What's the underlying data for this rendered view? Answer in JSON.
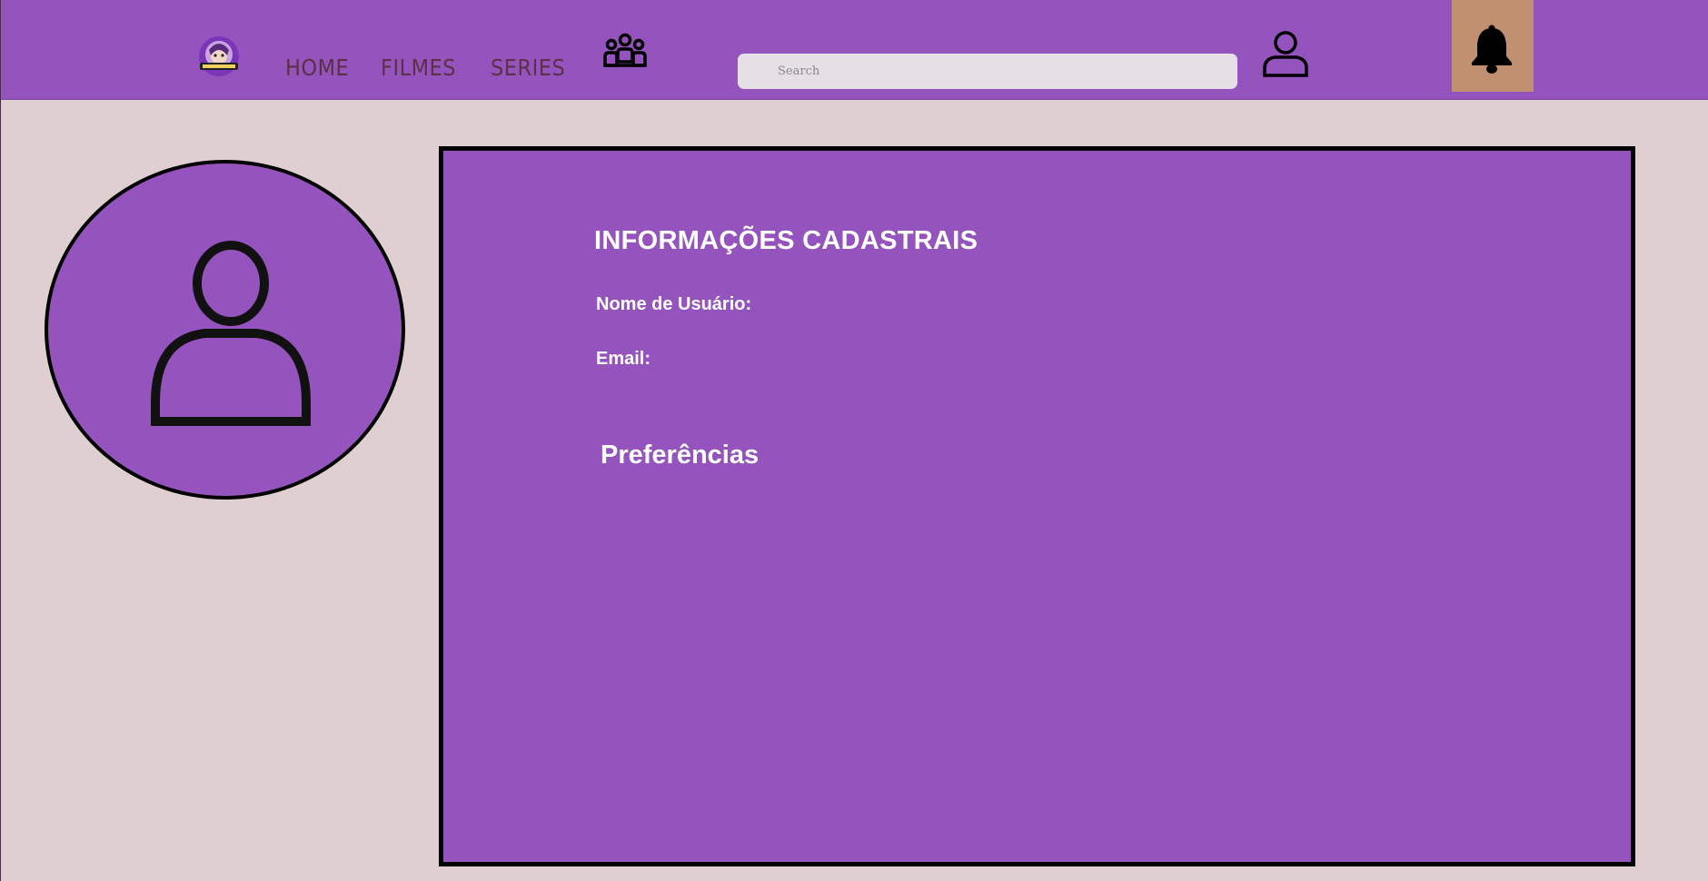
{
  "brand": {
    "logo_name": "animes-anime-logo"
  },
  "nav": {
    "home": "HOME",
    "filmes": "FILMES",
    "series": "SERIES"
  },
  "search": {
    "placeholder": "Search",
    "value": ""
  },
  "icons": {
    "group": "group-icon",
    "user": "user-icon",
    "bell": "bell-icon",
    "avatar": "avatar-icon"
  },
  "colors": {
    "header_bg": "#9553bd",
    "page_bg": "#e0cfd0",
    "panel_bg": "#9553bd",
    "bell_box_bg": "#c09070",
    "nav_text": "#5a3145"
  },
  "profile": {
    "section_title": "INFORMAÇÕES CADASTRAIS",
    "username_label": "Nome de Usuário:",
    "email_label": "Email:",
    "preferences_title": "Preferências"
  }
}
